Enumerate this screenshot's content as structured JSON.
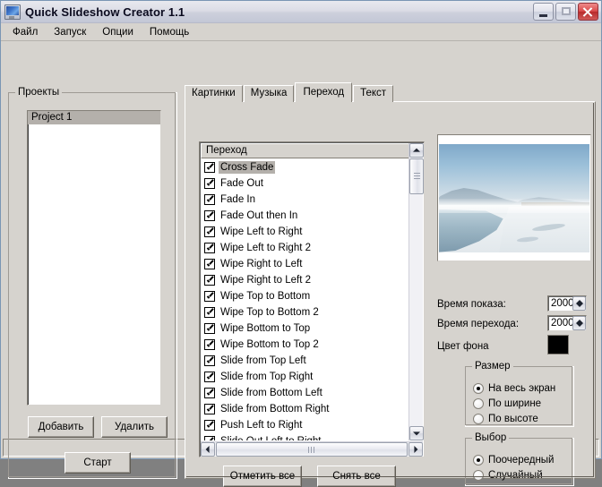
{
  "window": {
    "title": "Quick Slideshow Creator 1.1",
    "icon": "app-monitor-icon",
    "buttons": {
      "minimize": "–",
      "maximize": "□",
      "close": "✕"
    }
  },
  "menu": {
    "items": [
      "Файл",
      "Запуск",
      "Опции",
      "Помощь"
    ]
  },
  "projects": {
    "group_label": "Проекты",
    "items": [
      {
        "label": "Project 1",
        "selected": true
      }
    ],
    "buttons": {
      "add": "Добавить",
      "delete": "Удалить",
      "start": "Старт"
    }
  },
  "tabs": [
    {
      "label": "Картинки",
      "active": false
    },
    {
      "label": "Музыка",
      "active": false
    },
    {
      "label": "Переход",
      "active": true
    },
    {
      "label": "Текст",
      "active": false
    }
  ],
  "transitions": {
    "header": "Переход",
    "items": [
      {
        "label": "Cross Fade",
        "checked": true,
        "selected": true
      },
      {
        "label": "Fade Out",
        "checked": true,
        "selected": false
      },
      {
        "label": "Fade In",
        "checked": true,
        "selected": false
      },
      {
        "label": "Fade Out then In",
        "checked": true,
        "selected": false
      },
      {
        "label": "Wipe Left to Right",
        "checked": true,
        "selected": false
      },
      {
        "label": "Wipe Left to Right 2",
        "checked": true,
        "selected": false
      },
      {
        "label": "Wipe Right to Left",
        "checked": true,
        "selected": false
      },
      {
        "label": "Wipe Right to Left 2",
        "checked": true,
        "selected": false
      },
      {
        "label": "Wipe Top to Bottom",
        "checked": true,
        "selected": false
      },
      {
        "label": "Wipe Top to Bottom 2",
        "checked": true,
        "selected": false
      },
      {
        "label": "Wipe Bottom to Top",
        "checked": true,
        "selected": false
      },
      {
        "label": "Wipe Bottom to Top 2",
        "checked": true,
        "selected": false
      },
      {
        "label": "Slide from Top Left",
        "checked": true,
        "selected": false
      },
      {
        "label": "Slide from Top Right",
        "checked": true,
        "selected": false
      },
      {
        "label": "Slide from Bottom Left",
        "checked": true,
        "selected": false
      },
      {
        "label": "Slide from Bottom Right",
        "checked": true,
        "selected": false
      },
      {
        "label": "Push Left to Right",
        "checked": true,
        "selected": false
      },
      {
        "label": "Slide Out Left to Right",
        "checked": true,
        "selected": false
      }
    ],
    "buttons": {
      "check_all": "Отметить все",
      "uncheck_all": "Снять все"
    }
  },
  "settings": {
    "time_show_label": "Время показа:",
    "time_show_value": "2000",
    "time_transition_label": "Время перехода:",
    "time_transition_value": "2000",
    "bg_color_label": "Цвет фона",
    "bg_color_value": "#000000",
    "size": {
      "group_label": "Размер",
      "options": [
        {
          "label": "На весь экран",
          "selected": true
        },
        {
          "label": "По ширине",
          "selected": false
        },
        {
          "label": "По высоте",
          "selected": false
        }
      ]
    },
    "choice": {
      "group_label": "Выбор",
      "options": [
        {
          "label": "Поочередный",
          "selected": true
        },
        {
          "label": "Случайный",
          "selected": false
        }
      ]
    }
  },
  "preview": {
    "alt": "winter-landscape-preview"
  },
  "theme": {
    "face": "#d6d3ce",
    "selection": "#b4b0ab",
    "close_button": "#c0392b",
    "title_text": "#0a0a1e"
  }
}
